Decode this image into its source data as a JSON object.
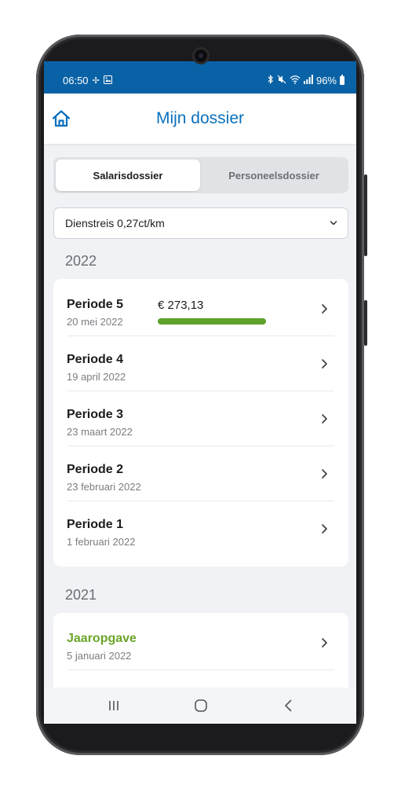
{
  "status_bar": {
    "time": "06:50",
    "battery": "96%",
    "left_icons": [
      "pinwheel-icon",
      "image-icon"
    ],
    "right_icons": [
      "bluetooth-icon",
      "mute-icon",
      "wifi-icon",
      "signal-icon",
      "battery-icon"
    ]
  },
  "header": {
    "title": "Mijn dossier",
    "home_icon": "home-icon"
  },
  "tabs": [
    {
      "label": "Salarisdossier",
      "active": true
    },
    {
      "label": "Personeelsdossier",
      "active": false
    }
  ],
  "filter": {
    "selected": "Dienstreis 0,27ct/km"
  },
  "sections": [
    {
      "year": "2022",
      "items": [
        {
          "title": "Periode 5",
          "date": "20 mei 2022",
          "amount": "€ 273,13",
          "progress": 1.0
        },
        {
          "title": "Periode 4",
          "date": "19 april 2022"
        },
        {
          "title": "Periode 3",
          "date": "23 maart 2022"
        },
        {
          "title": "Periode 2",
          "date": "23 februari 2022"
        },
        {
          "title": "Periode 1",
          "date": "1 februari 2022"
        }
      ]
    },
    {
      "year": "2021",
      "items": [
        {
          "title": "Jaaropgave",
          "date": "5 januari 2022"
        }
      ]
    }
  ],
  "colors": {
    "brand_blue": "#0a62a6",
    "title_blue": "#0a70bd",
    "accent_green": "#6ba52a",
    "progress_green": "#5ea22a"
  }
}
